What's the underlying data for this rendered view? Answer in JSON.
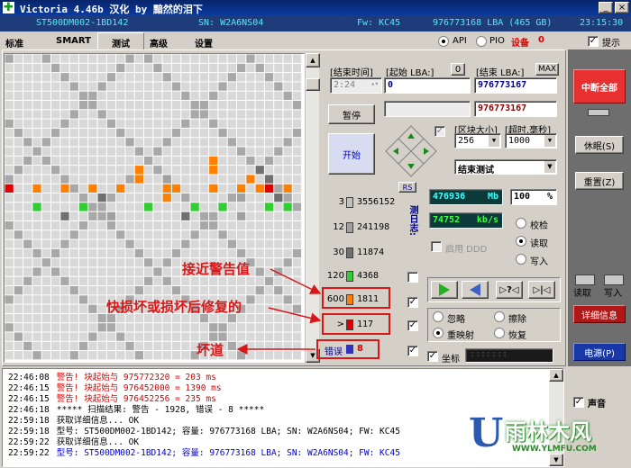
{
  "window": {
    "title": "Victoria 4.46b 汉化 by 黯然的泪下",
    "minimize": "_",
    "close": "×"
  },
  "infobar": {
    "model": "ST500DM002-1BD142",
    "serial": "SN: W2A6NS04",
    "firmware": "Fw: KC45",
    "capacity": "976773168 LBA (465 GB)",
    "time": "23:15:30"
  },
  "tabs": [
    "标准",
    "SMART",
    "测试",
    "高级",
    "设置"
  ],
  "active_tab": 2,
  "mode": {
    "api": "API",
    "pio": "PIO",
    "device_label": "设备",
    "device_num": "0",
    "hint": "提示"
  },
  "settings": {
    "end_time_label": "[结束时间]",
    "end_time_value": "2:24",
    "start_lba_label": "[起始 LBA:]",
    "start_lba_btn": "0",
    "start_lba_value": "0",
    "end_lba_label": "[结束 LBA:]",
    "max_btn": "MAX",
    "end_lba_value": "976773167",
    "end_lba_value2": "976773167",
    "pause_btn": "暂停",
    "start_btn": "开始",
    "block_size_label": "[区块大小]",
    "block_size_value": "256",
    "timeout_label": "[超时,毫秒]",
    "timeout_value": "1000",
    "action_value": "结束测试"
  },
  "legend": {
    "rs_btn": "RS",
    "rows": [
      {
        "threshold": "3",
        "count": "3556152",
        "color": "#c0c0c0"
      },
      {
        "threshold": "12",
        "count": "241198",
        "color": "#a0a0a0"
      },
      {
        "threshold": "30",
        "count": "11874",
        "color": "#707070"
      },
      {
        "threshold": "120",
        "count": "4368",
        "color": "#33cc33"
      },
      {
        "threshold": "600",
        "count": "1811",
        "color": "#ff8000"
      },
      {
        "threshold": ">",
        "count": "117",
        "color": "#dd0000"
      }
    ],
    "error_label": "错误",
    "error_count": "8",
    "vertical_label": "测日志:"
  },
  "stats": {
    "speed_value": "476936",
    "speed_unit": "Mb",
    "percent_value": "100",
    "percent_unit": "%",
    "rate_value": "74752",
    "rate_unit": "kb/s",
    "ddd_label": "启用 DDD",
    "verify": "校检",
    "read": "读取",
    "write": "写入",
    "ignore": "忽略",
    "erase": "擦除",
    "remap": "重映射",
    "restore": "恢复",
    "grid_label": "坐标",
    "grid_value": ":::::::"
  },
  "annotations": {
    "near_warning": "接近警告值",
    "fast_damage": "快损坏或损坏后修复的",
    "bad_sector": "坏道"
  },
  "sidebar": {
    "break_all": "中断全部",
    "sleep": "休眠(S)",
    "reset": "重置(Z)",
    "read": "读取",
    "write": "写入",
    "details": "详细信息",
    "power": "电源(P)",
    "sound": "声音"
  },
  "log": [
    {
      "time": "22:46:08",
      "text": "警告! 块起始与 975772320 = 203 ms",
      "color": "#dd0000"
    },
    {
      "time": "22:46:15",
      "text": "警告! 块起始与 976452000 = 1390 ms",
      "color": "#dd0000"
    },
    {
      "time": "22:46:15",
      "text": "警告! 块起始与 976452256 = 235 ms",
      "color": "#dd0000"
    },
    {
      "time": "22:46:18",
      "text": "***** 扫描结果: 警告 - 1928, 错误 - 8 *****",
      "color": "#000000"
    },
    {
      "time": "22:59:18",
      "text": "获取详细信息... OK",
      "color": "#000000"
    },
    {
      "time": "22:59:18",
      "text": "型号: ST500DM002-1BD142;     容量: 976773168 LBA; SN: W2A6NS04; FW: KC45",
      "color": "#000000"
    },
    {
      "time": "22:59:22",
      "text": "获取详细信息... OK",
      "color": "#000000"
    },
    {
      "time": "22:59:22",
      "text": "型号: ST500DM002-1BD142;     容量: 976773168 LBA; SN: W2A6NS04; FW: KC45",
      "color": "#0000cc"
    }
  ],
  "watermark": {
    "brand": "雨林木风",
    "url": "WWW.YLMFU.COM"
  }
}
